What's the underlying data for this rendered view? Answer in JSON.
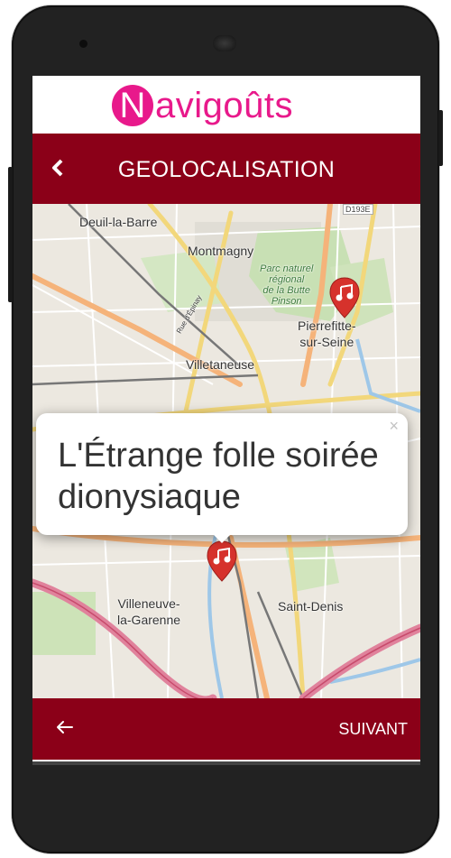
{
  "app": {
    "logo_initial": "N",
    "logo_rest": "avigoûts",
    "brand_color": "#e8198b",
    "header_color": "#8b0018"
  },
  "header": {
    "title": "GEOLOCALISATION",
    "back_icon": "chevron-left-icon"
  },
  "map": {
    "places": {
      "deuil": "Deuil-la-Barre",
      "montmagny": "Montmagny",
      "parc_line1": "Parc naturel",
      "parc_line2": "régional",
      "parc_line3": "de la Butte",
      "parc_line4": "Pinson",
      "pierrefitte_line1": "Pierrefitte-",
      "pierrefitte_line2": "sur-Seine",
      "villetaneuse": "Villetaneuse",
      "villeneuve_line1": "Villeneuve-",
      "villeneuve_line2": "la-Garenne",
      "saint_denis": "Saint-Denis",
      "rue_epinay": "Rue d'Épinay",
      "road_d193e": "D193E"
    },
    "markers_icon": "music-note-icon",
    "popup": {
      "text": "L'Étrange folle soirée dionysiaque",
      "close": "×"
    }
  },
  "footer": {
    "back_icon": "arrow-left-icon",
    "next_label": "SUIVANT"
  }
}
